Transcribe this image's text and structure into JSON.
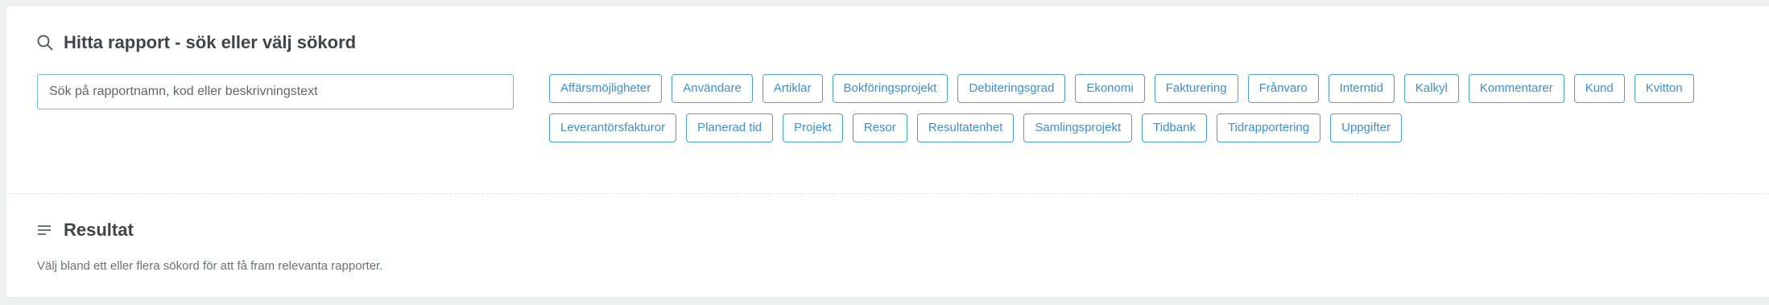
{
  "search": {
    "title": "Hitta rapport - sök eller välj sökord",
    "placeholder": "Sök på rapportnamn, kod eller beskrivningstext",
    "value": ""
  },
  "tags": {
    "row1": [
      "Affärsmöjligheter",
      "Användare",
      "Artiklar",
      "Bokföringsprojekt",
      "Debiteringsgrad",
      "Ekonomi",
      "Fakturering",
      "Frånvaro",
      "Interntid",
      "Kalkyl",
      "Kommentarer",
      "Kund",
      "Kvitton"
    ],
    "row2": [
      "Leverantörsfakturor",
      "Planerad tid",
      "Projekt",
      "Resor",
      "Resultatenhet",
      "Samlingsprojekt",
      "Tidbank",
      "Tidrapportering",
      "Uppgifter"
    ]
  },
  "results": {
    "title": "Resultat",
    "message": "Välj bland ett eller flera sökord för att få fram relevanta rapporter."
  },
  "colors": {
    "accent": "#4a9fd8",
    "tag_text": "#3d8fcf",
    "background": "#eef0f2",
    "panel": "#ffffff"
  },
  "icons": {
    "search_title_icon": "search-icon",
    "results_title_icon": "list-icon"
  }
}
